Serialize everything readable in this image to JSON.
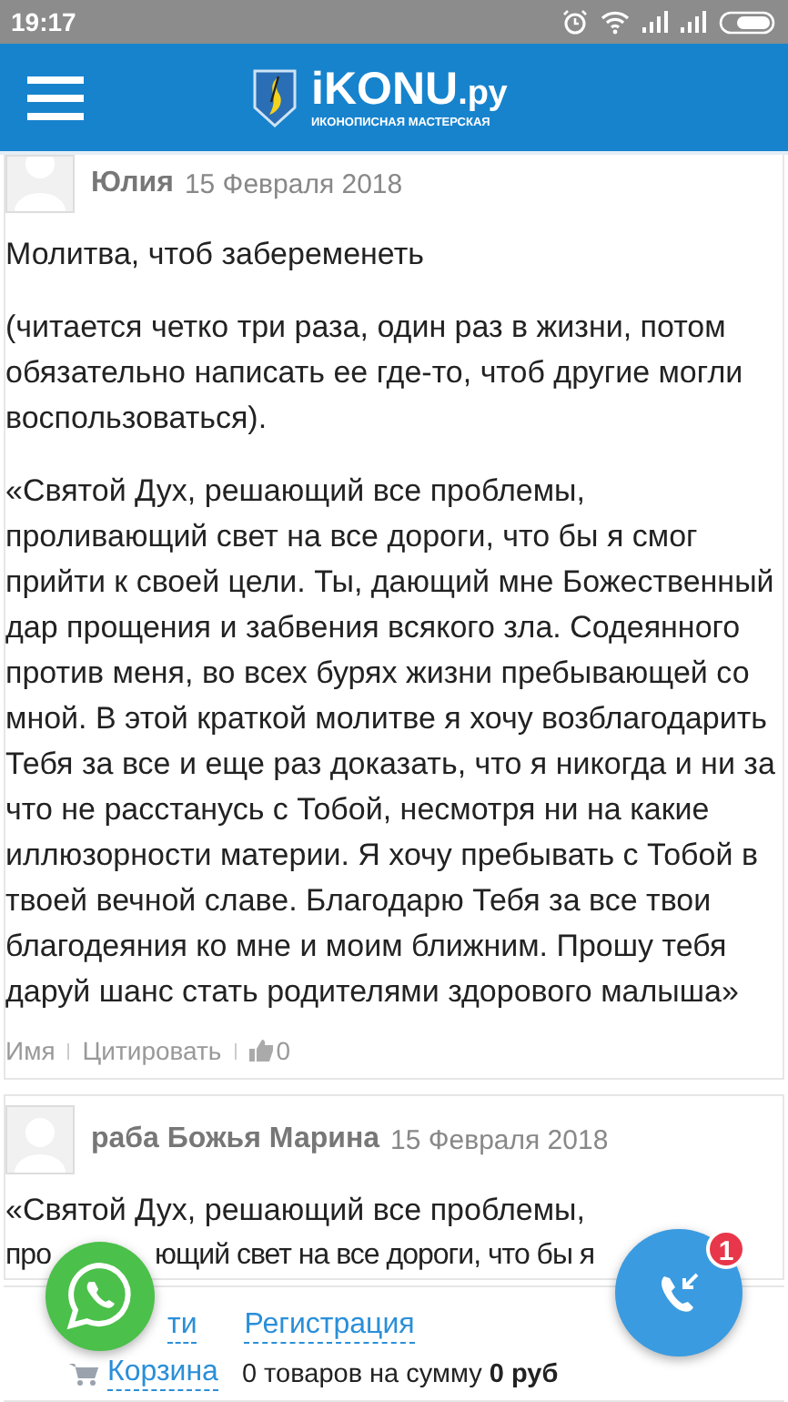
{
  "status_bar": {
    "time": "19:17"
  },
  "header": {
    "logo_title": "iKONU",
    "logo_suffix": ".ру",
    "logo_subtitle": "ИКОНОПИСНАЯ МАСТЕРСКАЯ"
  },
  "comments": [
    {
      "author": "Юлия",
      "date": "15 Февраля 2018",
      "paragraphs": [
        "Молитва, чтоб забеременеть",
        "(читается четко три раза, один раз в жизни, потом обязательно написать ее где-то, чтоб другие могли воспользоваться).",
        "«Святой Дух, решающий все проблемы, проливающий свет на все дороги, что бы я смог прийти к своей цели. Ты, дающий мне Божественный дар прощения и забвения всякого зла. Содеянного против меня, во всех бурях жизни пребывающей со мной. В этой краткой молитве я хочу возблагодарить Тебя за все и еще раз доказать, что я никогда и ни за что не расстанусь с Тобой, несмотря ни на какие иллюзорности материи. Я хочу пребывать с Тобой в твоей вечной славе. Благодарю Тебя за все твои благодеяния ко мне и моим ближним. Прошу тебя даруй шанс стать родителями здорового малыша»"
      ],
      "actions": [
        "Имя",
        "Цитировать"
      ],
      "likes": "0"
    },
    {
      "author": "раба Божья Марина",
      "date": "15 Февраля 2018",
      "line_1": " «Святой Дух, решающий все проблемы,",
      "line_2_parts": [
        "про",
        "ющий свет на все дороги, что бы я"
      ]
    }
  ],
  "footer": {
    "links": [
      "ти",
      "Регистрация"
    ],
    "cart_link": "Корзина",
    "cart_text": "0 товаров на сумму **0 руб**"
  },
  "call_button": {
    "badge": "1"
  }
}
